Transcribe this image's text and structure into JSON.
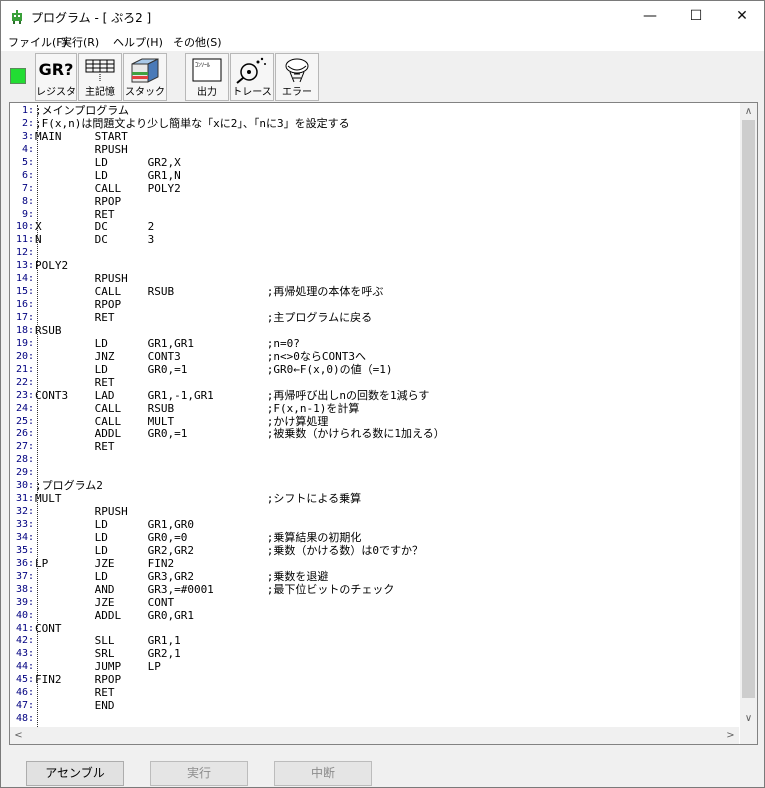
{
  "window": {
    "title": "プログラム - [ ぷろ2 ]",
    "minimize_glyph": "—",
    "maximize_glyph": "☐",
    "close_glyph": "✕"
  },
  "menu": [
    {
      "label": "ファイル(F)"
    },
    {
      "label": "実行(R)"
    },
    {
      "label": "ヘルプ(H)"
    },
    {
      "label": "その他(S)"
    }
  ],
  "toolbar": {
    "status_color": "#22dd33",
    "buttons": [
      {
        "label": "レジスタ",
        "icon": "register-icon",
        "icon_text": "GR?"
      },
      {
        "label": "主記憶",
        "icon": "memory-grid-icon"
      },
      {
        "label": "スタック",
        "icon": "stack-icon"
      },
      {
        "label": "出力",
        "icon": "console-icon",
        "icon_text": "ｺﾝｿｰﾙ"
      },
      {
        "label": "トレース",
        "icon": "trace-icon"
      },
      {
        "label": "エラー",
        "icon": "error-icon"
      }
    ]
  },
  "code_lines": [
    ";メインプログラム",
    ";F(x,n)は問題文より少し簡単な「xに2」、「nに3」を設定する",
    "MAIN     START",
    "         RPUSH",
    "         LD      GR2,X",
    "         LD      GR1,N",
    "         CALL    POLY2",
    "         RPOP",
    "         RET",
    "X        DC      2",
    "N        DC      3",
    "",
    "POLY2",
    "         RPUSH",
    "         CALL    RSUB              ;再帰処理の本体を呼ぶ",
    "         RPOP",
    "         RET                       ;主プログラムに戻る",
    "RSUB",
    "         LD      GR1,GR1           ;n=0?",
    "         JNZ     CONT3             ;n<>0ならCONT3へ",
    "         LD      GR0,=1            ;GR0←F(x,0)の値（=1)",
    "         RET",
    "CONT3    LAD     GR1,-1,GR1        ;再帰呼び出しnの回数を1減らす",
    "         CALL    RSUB              ;F(x,n-1)を計算",
    "         CALL    MULT              ;かけ算処理",
    "         ADDL    GR0,=1            ;被乗数（かけられる数に1加える）",
    "         RET",
    "",
    "",
    ";プログラム2",
    "MULT                               ;シフトによる乗算",
    "         RPUSH",
    "         LD      GR1,GR0",
    "         LD      GR0,=0            ;乗算結果の初期化",
    "         LD      GR2,GR2           ;乗数（かける数）は0ですか？",
    "LP       JZE     FIN2",
    "         LD      GR3,GR2           ;乗数を退避",
    "         AND     GR3,=#0001        ;最下位ビットのチェック",
    "         JZE     CONT",
    "         ADDL    GR0,GR1",
    "CONT",
    "         SLL     GR1,1",
    "         SRL     GR2,1",
    "         JUMP    LP",
    "FIN2     RPOP",
    "         RET",
    "         END",
    ""
  ],
  "scroll": {
    "up": "∧",
    "down": "∨",
    "left": "<",
    "right": ">"
  },
  "buttons": {
    "assemble": "アセンブル",
    "run": "実行",
    "abort": "中断"
  }
}
